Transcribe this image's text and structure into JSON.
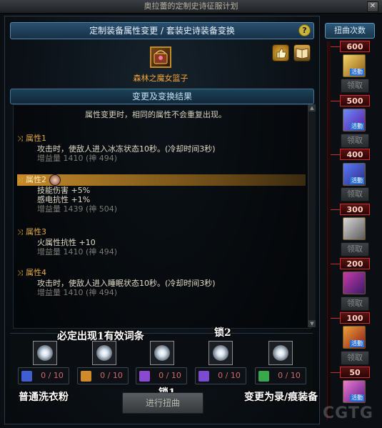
{
  "window": {
    "title": "奥拉蕾的定制史诗征服计划",
    "close_label": "✕"
  },
  "panel": {
    "header": "定制装备属性变更 / 套装史诗装备变换",
    "help_label": "?",
    "item_name": "森林之魔女篮子",
    "section_title": "变更及变换结果",
    "note": "属性变更时，相同的属性不会重复出现。"
  },
  "attributes": [
    {
      "name": "属性1",
      "lines": [
        "攻击时，使敌人进入冰冻状态10秒。(冷却时间3秒)"
      ],
      "gain": "增益量 1410 (神 494)",
      "selected": false
    },
    {
      "name": "属性2",
      "lines": [
        "技能伤害 +5%",
        "感电抗性 +1%"
      ],
      "gain": "增益量 1439 (神 504)",
      "selected": true
    },
    {
      "name": "属性3",
      "lines": [
        "火属性抗性 +10"
      ],
      "gain": "增益量 1410 (神 494)",
      "selected": false
    },
    {
      "name": "属性4",
      "lines": [
        "攻击时，使敌人进入睡眠状态10秒。(冷却时间3秒)"
      ],
      "gain": "增益量 1410 (神 494)",
      "selected": false
    }
  ],
  "slots": [
    {
      "count": "0 / 10",
      "color": "#3f5fd0"
    },
    {
      "count": "0 / 10",
      "color": "#d08a2a"
    },
    {
      "count": "0 / 10",
      "color": "#8a4ad0"
    },
    {
      "count": "0 / 10",
      "color": "#7a4ad0"
    },
    {
      "count": "0 / 10",
      "color": "#3aa84a"
    }
  ],
  "overlays": {
    "must_appear": "必定出现1有效词条",
    "lock2": "锁2",
    "lock1": "锁1",
    "normal_powder": "普通洗衣粉",
    "change_to": "变更为录/痕装备"
  },
  "action_button": "进行扭曲",
  "right_panel": {
    "tab": "扭曲次数",
    "tiers": [
      {
        "label": "600",
        "claim": "领取",
        "icon_color": "#c89a2a",
        "icon": "gift-box-icon"
      },
      {
        "label": "500",
        "claim": "领取",
        "icon_color": "#7a3ac8",
        "icon": "gift-box-icon"
      },
      {
        "label": "400",
        "claim": "领取",
        "icon_color": "#3a4ad0",
        "icon": "gift-box-icon"
      },
      {
        "label": "300",
        "claim": "领取",
        "icon_color": "#8a8a8a",
        "icon": "stone-icon"
      },
      {
        "label": "200",
        "claim": "领取",
        "icon_color": "#6a2a8a",
        "icon": "gift-box-icon"
      },
      {
        "label": "100",
        "claim": "领取",
        "icon_color": "#c84a2a",
        "icon": "gift-box-icon"
      },
      {
        "label": "50",
        "claim": "",
        "icon_color": "#b83ac0",
        "icon": "gift-box-icon"
      }
    ],
    "package_tag": "活動"
  },
  "watermark": "CGTG",
  "colors": {
    "accent_orange": "#f4a43a",
    "tier_red": "#d22a2a",
    "header_blue": "#2a5070"
  }
}
